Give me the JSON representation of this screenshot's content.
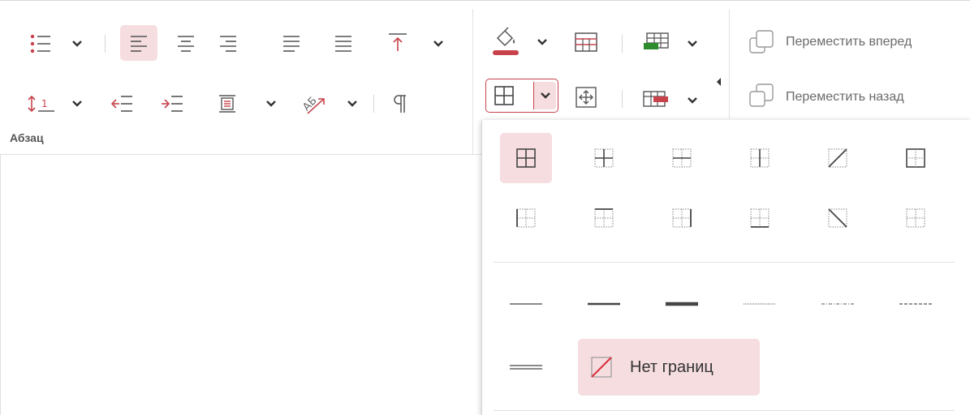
{
  "ribbon": {
    "paragraph_group_label": "Абзац",
    "move_forward_label": "Переместить вперед",
    "move_back_label": "Переместить назад"
  },
  "colors": {
    "accent": "#c8424b",
    "highlight_bg": "#f6dde0",
    "green": "#2e8b2e",
    "icon_gray": "#5a5a5a"
  },
  "borders_dropdown": {
    "no_borders_label": "Нет границ",
    "border_styles": [
      "solid-thin",
      "solid-medium",
      "solid-thick",
      "dotted",
      "dash-dot",
      "dashed",
      "double"
    ]
  }
}
